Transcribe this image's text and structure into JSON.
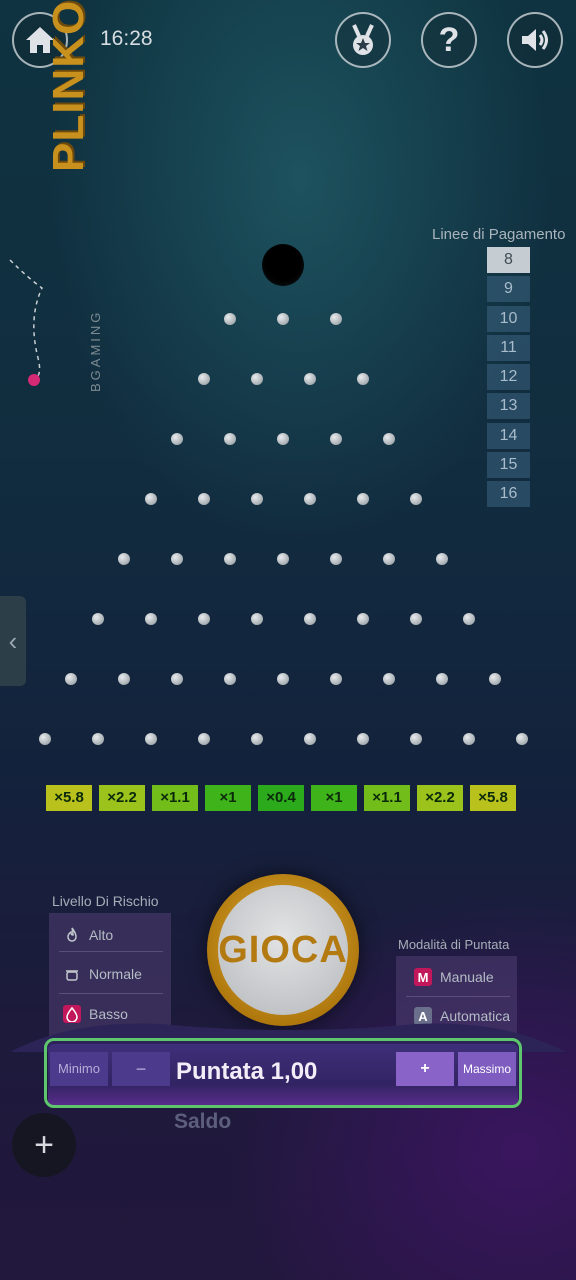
{
  "header": {
    "time": "16:28",
    "icons": [
      "home-icon",
      "medal-icon",
      "help-icon",
      "sound-icon"
    ]
  },
  "logo": {
    "title": "PLINKO",
    "subtitle": "BGAMING"
  },
  "paylines": {
    "title": "Linee di Pagamento",
    "options": [
      "8",
      "9",
      "10",
      "11",
      "12",
      "13",
      "14",
      "15",
      "16"
    ],
    "selected": "8"
  },
  "board": {
    "rows": 8
  },
  "multipliers": [
    {
      "label": "×5.8",
      "color": "#b9c21c"
    },
    {
      "label": "×2.2",
      "color": "#9cc21c"
    },
    {
      "label": "×1.1",
      "color": "#72bd1a"
    },
    {
      "label": "×1",
      "color": "#3fb31a"
    },
    {
      "label": "×0.4",
      "color": "#2bab1c"
    },
    {
      "label": "×1",
      "color": "#3fb31a"
    },
    {
      "label": "×1.1",
      "color": "#72bd1a"
    },
    {
      "label": "×2.2",
      "color": "#9cc21c"
    },
    {
      "label": "×5.8",
      "color": "#b9c21c"
    }
  ],
  "risk": {
    "title": "Livello Di Rischio",
    "options": [
      {
        "label": "Alto",
        "icon": "flame-icon"
      },
      {
        "label": "Normale",
        "icon": "pot-icon"
      },
      {
        "label": "Basso",
        "icon": "droplet-icon"
      }
    ]
  },
  "play": {
    "label": "GIOCA"
  },
  "mode": {
    "title": "Modalità di Puntata",
    "options": [
      {
        "label": "Manuale",
        "key": "M"
      },
      {
        "label": "Automatica",
        "key": "A"
      }
    ]
  },
  "bet": {
    "min_label": "Minimo",
    "minus_label": "−",
    "amount_text": "Puntata 1,00",
    "plus_label": "+",
    "max_label": "Massimo"
  },
  "balance": {
    "label": "Saldo"
  },
  "add": {
    "label": "+"
  }
}
